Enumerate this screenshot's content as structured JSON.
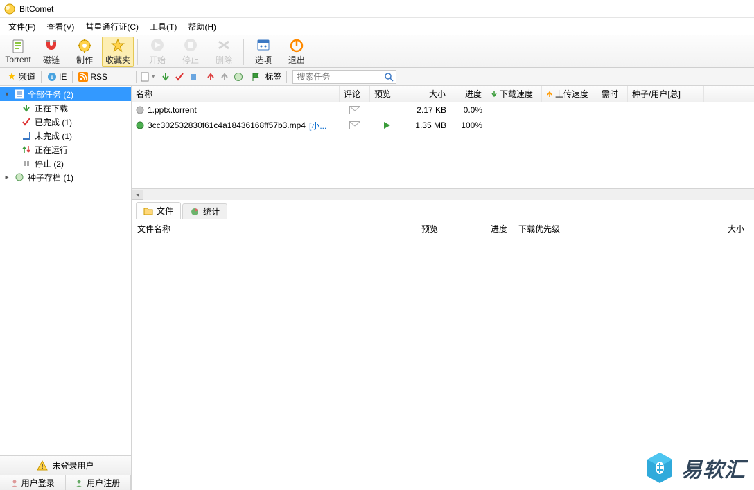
{
  "app": {
    "title": "BitComet"
  },
  "menu": {
    "file": "文件(F)",
    "view": "查看(V)",
    "pass": "彗星通行证(C)",
    "tools": "工具(T)",
    "help": "帮助(H)"
  },
  "toolbar": {
    "torrent": "Torrent",
    "magnet": "磁链",
    "make": "制作",
    "fav": "收藏夹",
    "start": "开始",
    "stop": "停止",
    "delete": "删除",
    "options": "选项",
    "exit": "退出"
  },
  "subbar": {
    "channel": "频道",
    "ie": "IE",
    "rss": "RSS",
    "tags": "标签",
    "search_placeholder": "搜索任务"
  },
  "tree": {
    "all": "全部任务 (2)",
    "downloading": "正在下载",
    "finished": "已完成 (1)",
    "unfinished": "未完成 (1)",
    "running": "正在运行",
    "stopped": "停止 (2)",
    "archive": "种子存档 (1)"
  },
  "columns": {
    "name": "名称",
    "comment": "评论",
    "preview": "预览",
    "size": "大小",
    "progress": "进度",
    "dl_speed": "下载速度",
    "ul_speed": "上传速度",
    "time": "需时",
    "seed_user": "种子/用户[总]"
  },
  "tasks": [
    {
      "status": "grey",
      "name": "1.pptx.torrent",
      "link": "",
      "comment": true,
      "preview": "",
      "size": "2.17 KB",
      "progress": "0.0%"
    },
    {
      "status": "green",
      "name": "3cc302532830f61c4a18436168ff57b3.mp4",
      "link": "[小...",
      "comment": true,
      "preview": "play",
      "size": "1.35 MB",
      "progress": "100%"
    }
  ],
  "tabs": {
    "file": "文件",
    "stats": "统计"
  },
  "filecols": {
    "fname": "文件名称",
    "fpreview": "预览",
    "fprogress": "进度",
    "fpriority": "下载优先级",
    "fsize": "大小"
  },
  "user": {
    "unlogged": "未登录用户",
    "login": "用户登录",
    "reg": "用户注册"
  },
  "watermark": {
    "text": "易软汇"
  }
}
